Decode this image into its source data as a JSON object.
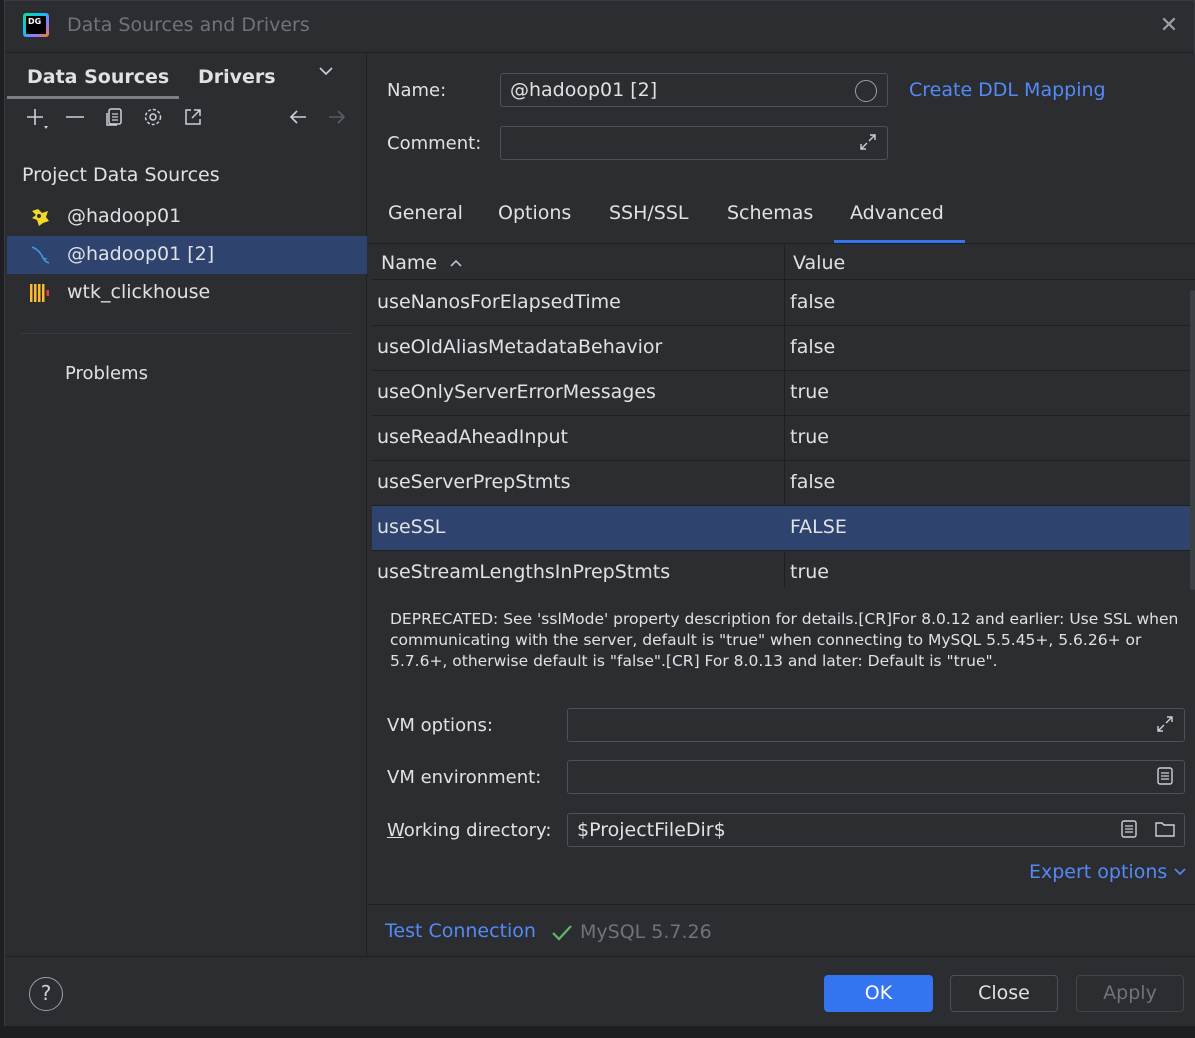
{
  "window": {
    "title": "Data Sources and Drivers",
    "logo_text": "DG"
  },
  "left_panel": {
    "tabs": [
      {
        "label": "Data Sources"
      },
      {
        "label": "Drivers"
      }
    ],
    "section_title": "Project Data Sources",
    "items": [
      {
        "label": "@hadoop01",
        "icon": "hive-icon"
      },
      {
        "label": "@hadoop01 [2]",
        "icon": "mysql-icon",
        "selected": true
      },
      {
        "label": "wtk_clickhouse",
        "icon": "clickhouse-icon"
      }
    ],
    "problems": "Problems"
  },
  "form": {
    "name_label": "Name:",
    "name_value": "@hadoop01 [2]",
    "comment_label": "Comment:",
    "comment_value": "",
    "ddl_link": "Create DDL Mapping"
  },
  "tabs": [
    {
      "label": "General"
    },
    {
      "label": "Options"
    },
    {
      "label": "SSH/SSL"
    },
    {
      "label": "Schemas"
    },
    {
      "label": "Advanced",
      "active": true
    }
  ],
  "table": {
    "col_name": "Name",
    "col_value": "Value",
    "rows": [
      {
        "name": "useNanosForElapsedTime",
        "value": "false"
      },
      {
        "name": "useOldAliasMetadataBehavior",
        "value": "false"
      },
      {
        "name": "useOnlyServerErrorMessages",
        "value": "true"
      },
      {
        "name": "useReadAheadInput",
        "value": "true"
      },
      {
        "name": "useServerPrepStmts",
        "value": "false"
      },
      {
        "name": "useSSL",
        "value": "FALSE",
        "selected": true
      },
      {
        "name": "useStreamLengthsInPrepStmts",
        "value": "true"
      }
    ]
  },
  "description": "DEPRECATED: See 'sslMode' property description for details.[CR]For 8.0.12 and earlier: Use SSL when communicating with the server, default is \"true\" when connecting to MySQL 5.5.45+, 5.6.26+ or 5.7.6+, otherwise default is \"false\".[CR] For 8.0.13 and later: Default is \"true\".",
  "vm": {
    "options_label": "VM options:",
    "options_value": "",
    "env_label": "VM environment:",
    "env_value": "",
    "workdir_label_mnemonic": "W",
    "workdir_label_rest": "orking directory:",
    "workdir_value": "$ProjectFileDir$",
    "expert": "Expert options"
  },
  "test": {
    "link": "Test Connection",
    "status": "MySQL 5.7.26"
  },
  "buttons": {
    "ok": "OK",
    "close": "Close",
    "apply": "Apply",
    "help": "?"
  },
  "colors": {
    "accent": "#3574f0",
    "link": "#548af7",
    "selection": "#2e436e",
    "success": "#5fb865"
  }
}
